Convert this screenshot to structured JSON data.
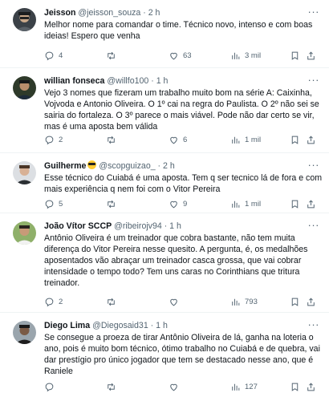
{
  "tweets": [
    {
      "name": "Jeisson",
      "handle": "@jeisson_souza · 2 h",
      "lines": [
        "Melhor nome para comandar o time. Técnico novo, intenso e com boas",
        "ideias! Espero que venha"
      ],
      "replies": "4",
      "retweets": "",
      "likes": "63",
      "views": "3 mil"
    },
    {
      "name": "willian fonseca",
      "handle": "@willfo100 · 1 h",
      "lines": [
        "Vejo 3 nomes que fizeram um trabalho muito bom na série A: Caixinha,",
        "Vojvoda e Antonio Oliveira. O 1º cai na regra do Paulista. O 2º não sei se",
        "sairia do fortaleza. O 3º parece o mais viável. Pode não dar certo se vir,",
        "mas é uma aposta bem válida"
      ],
      "replies": "2",
      "retweets": "",
      "likes": "6",
      "views": "1 mil"
    },
    {
      "name": "Guilherme",
      "handle": "@scopguizao_ · 2 h",
      "lines": [
        "Esse técnico do Cuiabá é uma aposta. Tem q ser tecnico lá de fora e com",
        "mais experiência q nem foi com o Vitor Pereira"
      ],
      "replies": "5",
      "retweets": "",
      "likes": "9",
      "views": "1 mil"
    },
    {
      "name": "João Vítor SCCP",
      "handle": "@ribeirojv94 · 1 h",
      "lines": [
        "Antônio Oliveira é um treinador que cobra bastante, não tem muita",
        "diferença do Vitor Pereira nesse quesito. A pergunta, é, os medalhões",
        "aposentados vão abraçar um treinador casca grossa, que vai cobrar",
        "intensidade o tempo todo? Tem uns caras no Corinthians que tritura",
        "treinador."
      ],
      "replies": "2",
      "retweets": "",
      "likes": "",
      "views": "793"
    },
    {
      "name": "Diego Lima",
      "handle": "@Diegosaid31 · 1 h",
      "lines": [
        "Se consegue a proeza de tirar Antônio Oliveira de lá, ganha na loteria o",
        "ano, pois é muito bom técnico, ótimo trabalho no Cuiabá e de quebra, vai",
        "dar prestígio pro único jogador que tem se destacado nesse ano, que é",
        "Raniele"
      ],
      "replies": "",
      "retweets": "",
      "likes": "",
      "views": "127"
    }
  ],
  "icons": {
    "reply": "reply-icon",
    "retweet": "retweet-icon",
    "like": "heart-icon",
    "views": "views-icon",
    "bookmark": "bookmark-icon",
    "share": "share-icon",
    "more": "more-icon"
  },
  "colors": {
    "muted": "#536471",
    "text": "#0f1419",
    "divider": "#eff3f4"
  }
}
